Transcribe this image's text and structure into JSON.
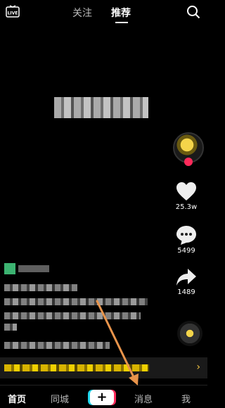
{
  "top_tabs": {
    "follow": "关注",
    "recommend": "推荐"
  },
  "live_label": "LIVE",
  "actions": {
    "likes": "25.3w",
    "comments": "5499",
    "shares": "1489"
  },
  "bottom_nav": {
    "home": "首页",
    "local": "同城",
    "create": "+",
    "messages": "消息",
    "me": "我"
  },
  "colors": {
    "accent_pink": "#ff2a5a",
    "accent_cyan": "#20d5ec",
    "highlight": "#f4c542",
    "annotation_arrow": "#e8944b"
  },
  "icons": [
    "live-icon",
    "search-icon",
    "heart-icon",
    "comment-icon",
    "share-icon",
    "music-disc-icon",
    "chevron-right-icon"
  ]
}
